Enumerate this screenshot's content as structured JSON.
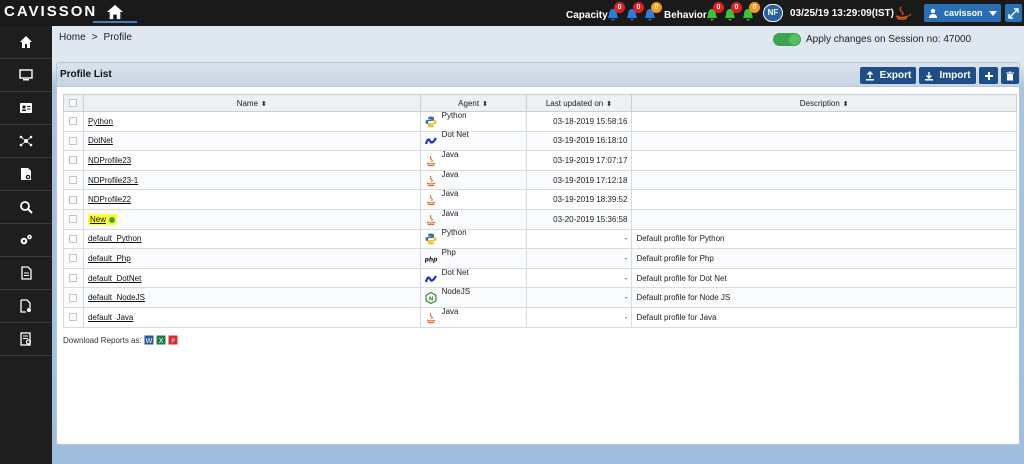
{
  "brand": "CAVISSON",
  "topbar": {
    "capacity_label": "Capacity",
    "capacity_badges": [
      "0",
      "0",
      "0"
    ],
    "behavior_label": "Behavior",
    "behavior_badges": [
      "0",
      "0",
      "0"
    ],
    "avatar": "NF",
    "datetime": "03/25/19 13:29:09(IST)",
    "user": "cavisson"
  },
  "breadcrumb": {
    "home": "Home",
    "sep": ">",
    "current": "Profile"
  },
  "session": {
    "text": "Apply changes on Session no: 47000",
    "toggle_on": true
  },
  "panel": {
    "title": "Profile List",
    "export_label": "Export",
    "import_label": "Import"
  },
  "table": {
    "headers": {
      "name": "Name",
      "agent": "Agent",
      "updated": "Last updated on",
      "description": "Description"
    },
    "rows": [
      {
        "name": "Python",
        "agent": "Python",
        "updated": "03-18-2019 15:58:16",
        "description": "",
        "icon": "python-icon"
      },
      {
        "name": "DotNet",
        "agent": "Dot Net",
        "updated": "03-19-2019 16:18:10",
        "description": "",
        "icon": "dotnet-icon"
      },
      {
        "name": "NDProfile23",
        "agent": "Java",
        "updated": "03-19-2019 17:07:17",
        "description": "",
        "icon": "java-icon"
      },
      {
        "name": "NDProfile23-1",
        "agent": "Java",
        "updated": "03-19-2019 17:12:18",
        "description": "",
        "icon": "java-icon"
      },
      {
        "name": "NDProfile22",
        "agent": "Java",
        "updated": "03-19-2019 18:39:52",
        "description": "",
        "icon": "java-icon"
      },
      {
        "name": "New",
        "agent": "Java",
        "updated": "03-20-2019 15:36:58",
        "description": "",
        "icon": "java-icon",
        "highlighted": true,
        "active": true
      },
      {
        "name": "default_Python",
        "agent": "Python",
        "updated": "-",
        "description": "Default profile for Python",
        "icon": "python-icon"
      },
      {
        "name": "default_Php",
        "agent": "Php",
        "updated": "-",
        "description": "Default profile for Php",
        "icon": "php-icon"
      },
      {
        "name": "default_DotNet",
        "agent": "Dot Net",
        "updated": "-",
        "description": "Default profile for Dot Net",
        "icon": "dotnet-icon"
      },
      {
        "name": "default_NodeJS",
        "agent": "NodeJS",
        "updated": "-",
        "description": "Default profile for Node JS",
        "icon": "nodejs-icon"
      },
      {
        "name": "default_Java",
        "agent": "Java",
        "updated": "-",
        "description": "Default profile for Java",
        "icon": "java-icon"
      }
    ]
  },
  "download_reports_label": "Download Reports as:",
  "colors": {
    "topbar": "#1a1a1a",
    "accent": "#1f4d85",
    "highlight": "#ffff33",
    "active_dot": "#3aa746"
  }
}
